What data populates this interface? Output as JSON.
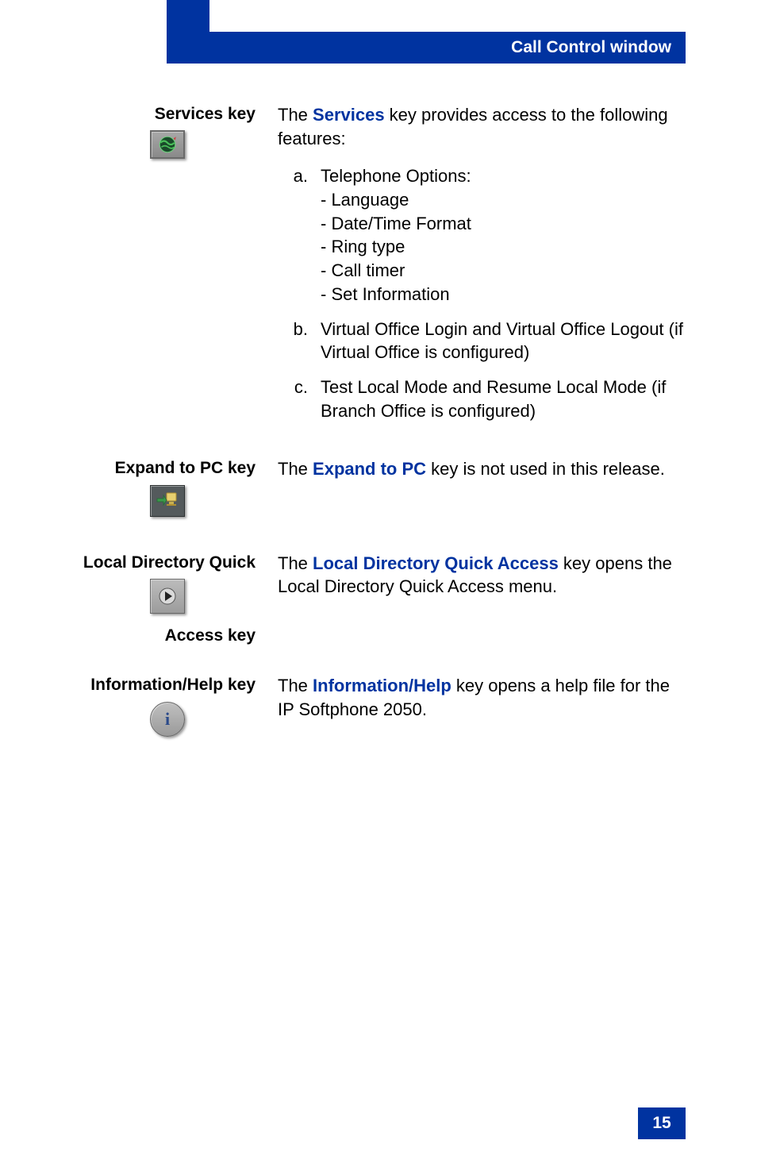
{
  "header": {
    "title": "Call Control window"
  },
  "page_number": "15",
  "sections": {
    "services": {
      "label": "Services key",
      "intro_pre": "The ",
      "intro_term": "Services",
      "intro_post": " key provides access to the following features:",
      "a_marker": "a.",
      "a_lead": "Telephone Options:",
      "a_sub": [
        "- Language",
        "- Date/Time Format",
        "- Ring type",
        "- Call timer",
        "- Set Information"
      ],
      "b_marker": "b.",
      "b_text": "Virtual Office Login and Virtual Office Logout (if Virtual Office is configured)",
      "c_marker": "c.",
      "c_text": "Test Local Mode and Resume Local Mode (if Branch Office is configured)"
    },
    "expand": {
      "label": "Expand to PC key",
      "pre": "The ",
      "term": "Expand to PC",
      "post": " key is not used in this release."
    },
    "directory": {
      "label_line1": "Local Directory Quick",
      "label_line2": "Access key",
      "pre": "The ",
      "term": "Local Directory Quick Access",
      "post": " key opens the Local Directory Quick Access menu."
    },
    "help": {
      "label": "Information/Help key",
      "pre": "The ",
      "term": "Information/Help",
      "post": " key opens a help file for the IP Softphone 2050."
    }
  }
}
